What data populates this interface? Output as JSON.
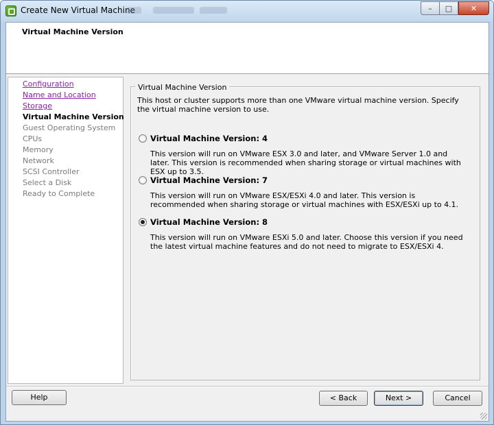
{
  "window": {
    "title": "Create New Virtual Machine",
    "minimize_label": "–",
    "maximize_label": "□",
    "close_label": "✕"
  },
  "header": {
    "title": "Virtual Machine Version"
  },
  "nav": {
    "items": [
      {
        "label": "Configuration",
        "state": "link"
      },
      {
        "label": "Name and Location",
        "state": "link"
      },
      {
        "label": "Storage",
        "state": "link"
      },
      {
        "label": "Virtual Machine Version",
        "state": "current"
      },
      {
        "label": "Guest Operating System",
        "state": "disabled"
      },
      {
        "label": "CPUs",
        "state": "disabled"
      },
      {
        "label": "Memory",
        "state": "disabled"
      },
      {
        "label": "Network",
        "state": "disabled"
      },
      {
        "label": "SCSI Controller",
        "state": "disabled"
      },
      {
        "label": "Select a Disk",
        "state": "disabled"
      },
      {
        "label": "Ready to Complete",
        "state": "disabled"
      }
    ]
  },
  "content": {
    "group_title": "Virtual Machine Version",
    "intro": "This host or cluster supports more than one VMware virtual machine version. Specify the virtual machine version to use.",
    "options": [
      {
        "title": "Virtual Machine Version: 4",
        "description": "This version will run on VMware ESX 3.0 and later, and VMware Server 1.0 and later. This version is recommended when sharing storage or virtual machines with ESX up to 3.5.",
        "selected": false
      },
      {
        "title": "Virtual Machine Version: 7",
        "description": "This version will run on VMware ESX/ESXi 4.0 and later. This version is recommended when sharing storage or virtual machines with ESX/ESXi up to 4.1.",
        "selected": false
      },
      {
        "title": "Virtual Machine Version: 8",
        "description": "This version will run on VMware ESXi 5.0 and later. Choose this version if you need the latest virtual machine features and do not need to migrate to ESX/ESXi 4.",
        "selected": true
      }
    ]
  },
  "buttons": {
    "help": "Help",
    "back": "< Back",
    "next": "Next >",
    "cancel": "Cancel"
  },
  "colors": {
    "link": "#8a1ea8",
    "disabled": "#7a7a7a",
    "chrome": "#bcd3ea"
  }
}
